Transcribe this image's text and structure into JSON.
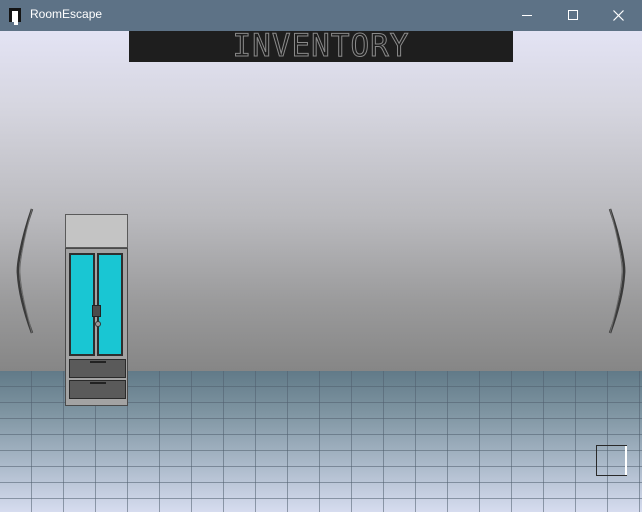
{
  "window": {
    "title": "RoomEscape",
    "icon": "app-door-icon",
    "controls": {
      "minimize_icon": "minimize-icon",
      "maximize_icon": "maximize-icon",
      "close_icon": "close-icon"
    }
  },
  "scene": {
    "inventory_label": "INVENTORY",
    "nav_left_icon": "left-arrow-icon",
    "nav_right_icon": "right-arrow-icon",
    "objects": [
      "refrigerator"
    ],
    "colors": {
      "titlebar": "#5d7286",
      "inventory_bg": "#1e1e1e",
      "fridge_glass": "#19c6d3"
    }
  }
}
